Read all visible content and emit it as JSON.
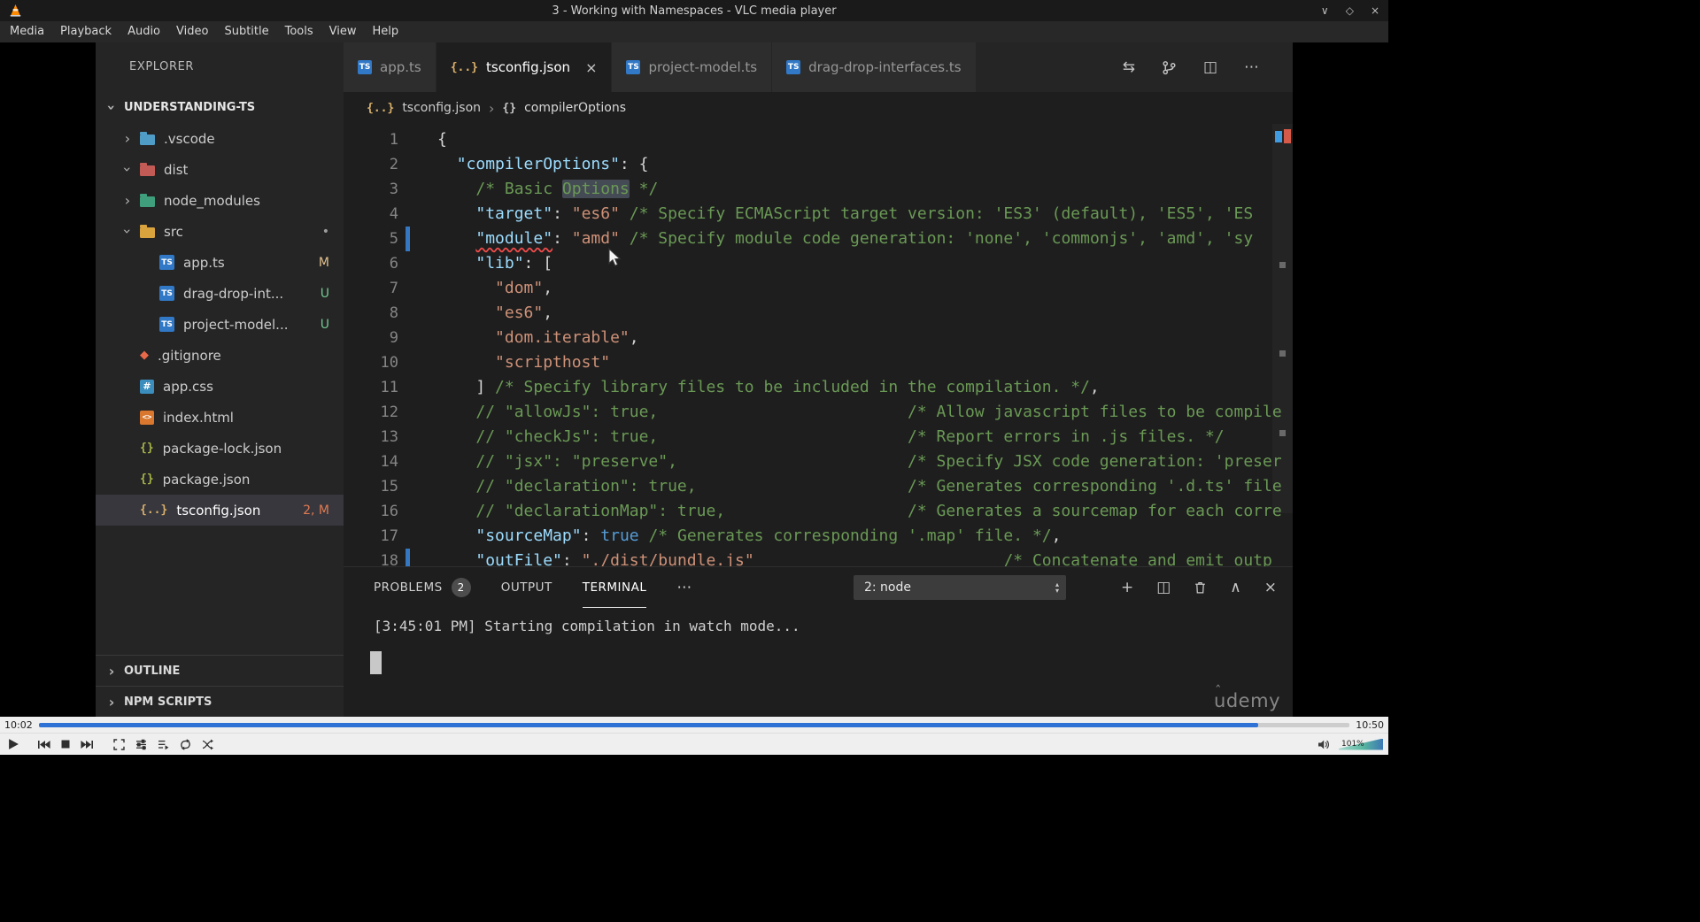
{
  "icons": {
    "chevron": "›",
    "close": "×",
    "diff": "⇆",
    "split_editor": "◫",
    "more": "⋯",
    "plus": "+",
    "panel_collapse": "∧",
    "panel_close": "×",
    "arrow_up": "▴",
    "arrow_down": "▾",
    "win_minimize": "∨",
    "win_maximize": "◇",
    "win_close": "×",
    "ts_braces": "{..}",
    "symbol_braces": "{}",
    "watermark_caret": "ˆ"
  },
  "vlc": {
    "title": "3 - Working with Namespaces - VLC media player",
    "menu": [
      "Media",
      "Playback",
      "Audio",
      "Video",
      "Subtitle",
      "Tools",
      "View",
      "Help"
    ],
    "seek": {
      "elapsed": "10:02",
      "total": "10:50",
      "progress_pct": 93
    },
    "controls": {
      "volume_label": "101%"
    }
  },
  "vscode": {
    "explorer": {
      "header": "EXPLORER",
      "root": "UNDERSTANDING-TS",
      "tree": [
        {
          "label": ".vscode",
          "kind": "folder",
          "chevron": "right",
          "color": "#4f9cc6"
        },
        {
          "label": "dist",
          "kind": "folder",
          "chevron": "down",
          "color": "#c25b56"
        },
        {
          "label": "node_modules",
          "kind": "folder",
          "chevron": "right",
          "color": "#3f9e7c"
        },
        {
          "label": "src",
          "kind": "folder",
          "chevron": "down",
          "color": "#d9a33e",
          "badge": "•",
          "badge_color": "#9d9d9d"
        },
        {
          "label": "app.ts",
          "kind": "ts",
          "indent": 1,
          "badge": "M",
          "badge_color": "#e2c08d"
        },
        {
          "label": "drag-drop-int...",
          "kind": "ts",
          "indent": 1,
          "badge": "U",
          "badge_color": "#73c991"
        },
        {
          "label": "project-model...",
          "kind": "ts",
          "indent": 1,
          "badge": "U",
          "badge_color": "#73c991"
        },
        {
          "label": ".gitignore",
          "kind": "git"
        },
        {
          "label": "app.css",
          "kind": "css"
        },
        {
          "label": "index.html",
          "kind": "html"
        },
        {
          "label": "package-lock.json",
          "kind": "json"
        },
        {
          "label": "package.json",
          "kind": "json"
        },
        {
          "label": "tsconfig.json",
          "kind": "tsconfig",
          "badge": "2, M",
          "badge_color": "#e07a52",
          "selected": true
        }
      ],
      "bottom_sections": [
        "OUTLINE",
        "NPM SCRIPTS"
      ]
    },
    "editor": {
      "tabs": [
        {
          "label": "app.ts",
          "icon": "ts",
          "active": false
        },
        {
          "label": "tsconfig.json",
          "icon": "tsconfig",
          "active": true,
          "close": true
        },
        {
          "label": "project-model.ts",
          "icon": "ts",
          "active": false
        },
        {
          "label": "drag-drop-interfaces.ts",
          "icon": "ts",
          "active": false
        }
      ],
      "breadcrumb": {
        "file": "tsconfig.json",
        "symbol": "compilerOptions"
      },
      "code": {
        "lines": [
          {
            "n": 1,
            "seg": [
              [
                "p",
                "{"
              ]
            ]
          },
          {
            "n": 2,
            "seg": [
              [
                "p",
                "  "
              ],
              [
                "k",
                "\"compilerOptions\""
              ],
              [
                "p",
                ": {"
              ]
            ]
          },
          {
            "n": 3,
            "seg": [
              [
                "p",
                "    "
              ],
              [
                "c",
                "/* Basic "
              ],
              [
                "c hl",
                "Options"
              ],
              [
                "c",
                " */"
              ]
            ]
          },
          {
            "n": 4,
            "seg": [
              [
                "p",
                "    "
              ],
              [
                "k",
                "\"target\""
              ],
              [
                "p",
                ": "
              ],
              [
                "s",
                "\"es6\""
              ],
              [
                "p",
                " "
              ],
              [
                "c",
                "/* Specify ECMAScript target version: 'ES3' (default), 'ES5', 'ES"
              ]
            ]
          },
          {
            "n": 5,
            "mod": true,
            "seg": [
              [
                "p",
                "    "
              ],
              [
                "k err",
                "\"module\""
              ],
              [
                "p",
                ": "
              ],
              [
                "s",
                "\"amd\""
              ],
              [
                "p",
                " "
              ],
              [
                "c",
                "/* Specify module code generation: 'none', 'commonjs', 'amd', 'sy"
              ]
            ]
          },
          {
            "n": 6,
            "seg": [
              [
                "p",
                "    "
              ],
              [
                "k",
                "\"lib\""
              ],
              [
                "p",
                ": ["
              ]
            ]
          },
          {
            "n": 7,
            "seg": [
              [
                "p",
                "      "
              ],
              [
                "s",
                "\"dom\""
              ],
              [
                "p",
                ","
              ]
            ]
          },
          {
            "n": 8,
            "seg": [
              [
                "p",
                "      "
              ],
              [
                "s",
                "\"es6\""
              ],
              [
                "p",
                ","
              ]
            ]
          },
          {
            "n": 9,
            "seg": [
              [
                "p",
                "      "
              ],
              [
                "s",
                "\"dom.iterable\""
              ],
              [
                "p",
                ","
              ]
            ]
          },
          {
            "n": 10,
            "seg": [
              [
                "p",
                "      "
              ],
              [
                "s",
                "\"scripthost\""
              ]
            ]
          },
          {
            "n": 11,
            "seg": [
              [
                "p",
                "    ] "
              ],
              [
                "c",
                "/* Specify library files to be included in the compilation. */"
              ],
              [
                "p",
                ","
              ]
            ]
          },
          {
            "n": 12,
            "seg": [
              [
                "p",
                "    "
              ],
              [
                "c",
                "// \"allowJs\": true,                          /* Allow javascript files to be compile"
              ]
            ]
          },
          {
            "n": 13,
            "seg": [
              [
                "p",
                "    "
              ],
              [
                "c",
                "// \"checkJs\": true,                          /* Report errors in .js files. */"
              ]
            ]
          },
          {
            "n": 14,
            "seg": [
              [
                "p",
                "    "
              ],
              [
                "c",
                "// \"jsx\": \"preserve\",                        /* Specify JSX code generation: 'preser"
              ]
            ]
          },
          {
            "n": 15,
            "seg": [
              [
                "p",
                "    "
              ],
              [
                "c",
                "// \"declaration\": true,                      /* Generates corresponding '.d.ts' file"
              ]
            ]
          },
          {
            "n": 16,
            "seg": [
              [
                "p",
                "    "
              ],
              [
                "c",
                "// \"declarationMap\": true,                   /* Generates a sourcemap for each corre"
              ]
            ]
          },
          {
            "n": 17,
            "seg": [
              [
                "p",
                "    "
              ],
              [
                "k",
                "\"sourceMap\""
              ],
              [
                "p",
                ": "
              ],
              [
                "b",
                "true"
              ],
              [
                "p",
                " "
              ],
              [
                "c",
                "/* Generates corresponding '.map' file. */"
              ],
              [
                "p",
                ","
              ]
            ]
          },
          {
            "n": 18,
            "mod": true,
            "seg": [
              [
                "p",
                "    "
              ],
              [
                "k",
                "\"outFile\""
              ],
              [
                "p",
                ": "
              ],
              [
                "s",
                "\"./dist/bundle.js\""
              ],
              [
                "p",
                "                          "
              ],
              [
                "c",
                "/* Concatenate and emit outp"
              ]
            ]
          }
        ]
      }
    },
    "panel": {
      "tabs": [
        {
          "label": "PROBLEMS",
          "badge": "2"
        },
        {
          "label": "OUTPUT"
        },
        {
          "label": "TERMINAL",
          "active": true
        }
      ],
      "terminal_picker": "2: node",
      "output_line": "[3:45:01 PM] Starting compilation in watch mode..."
    },
    "watermark": "udemy"
  }
}
